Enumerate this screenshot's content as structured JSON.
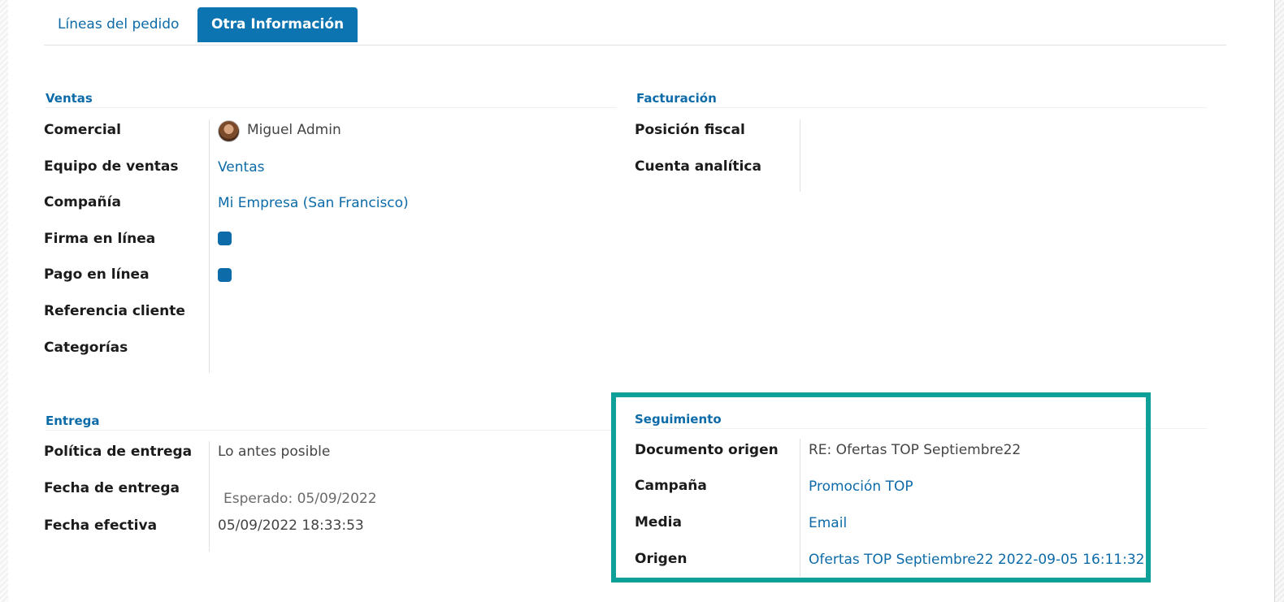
{
  "tabs": [
    {
      "label": "Líneas del pedido",
      "active": false
    },
    {
      "label": "Otra Información",
      "active": true
    }
  ],
  "ventas": {
    "title": "Ventas",
    "comercial_label": "Comercial",
    "comercial_value": "Miguel Admin",
    "equipo_label": "Equipo de ventas",
    "equipo_value": "Ventas",
    "compania_label": "Compañía",
    "compania_value": "Mi Empresa (San Francisco)",
    "firma_label": "Firma en línea",
    "firma_checked": true,
    "pago_label": "Pago en línea",
    "pago_checked": true,
    "referencia_label": "Referencia cliente",
    "categorias_label": "Categorías"
  },
  "facturacion": {
    "title": "Facturación",
    "posicion_label": "Posición fiscal",
    "cuenta_label": "Cuenta analítica"
  },
  "entrega": {
    "title": "Entrega",
    "politica_label": "Política de entrega",
    "politica_value": "Lo antes posible",
    "fecha_label": "Fecha de entrega",
    "fecha_value": "Esperado: 05/09/2022",
    "efectiva_label": "Fecha efectiva",
    "efectiva_value": "05/09/2022 18:33:53"
  },
  "seguimiento": {
    "title": "Seguimiento",
    "documento_label": "Documento origen",
    "documento_value": "RE: Ofertas TOP Septiembre22",
    "campana_label": "Campaña",
    "campana_value": "Promoción TOP",
    "media_label": "Media",
    "media_value": "Email",
    "origen_label": "Origen",
    "origen_value": "Ofertas TOP Septiembre22 2022-09-05 16:11:32"
  },
  "colors": {
    "accent": "#0c74b0",
    "link": "#0c6ba8",
    "highlight": "#0fa09a"
  }
}
